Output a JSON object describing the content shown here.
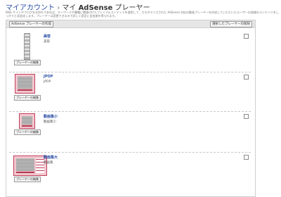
{
  "breadcrumb": {
    "parent": "マイアカウント",
    "separator": "›",
    "current_prefix": "マイ",
    "current_strong": "AdSense",
    "current_suffix": "プレーヤー"
  },
  "description": "Web サイトやブログをお持ちであれば、キーワードや書籍に関連付けたプレミアムコンテンツを使用して、カスタマイズされた AdSense 対応の動画プレーヤーを作成していただいたユーザーの皆様のコンテンツをしっかりと収益化します。プレーヤーは変更できるので詳しく設定に自由度を得られます。",
  "toolbar": {
    "create_label": "AdSense プレーヤーの作成",
    "remove_label": "選択したプレーヤーの削除"
  },
  "players": [
    {
      "name": "美容",
      "subtitle": "美容",
      "edit_label": "プレーヤーの編集",
      "checked": false
    },
    {
      "name": "JPOP",
      "subtitle": "JPOP",
      "edit_label": "プレーヤーの編集",
      "checked": false
    },
    {
      "name": "動画集小",
      "subtitle": "動画集小",
      "edit_label": "プレーヤーの編集",
      "checked": false
    },
    {
      "name": "動画集大",
      "subtitle": "動画集",
      "edit_label": "プレーヤーの編集",
      "checked": false
    }
  ],
  "colors": {
    "link": "#2a4ea6",
    "accent": "#c0405a",
    "toolbar_bg": "#e6e6e6"
  }
}
